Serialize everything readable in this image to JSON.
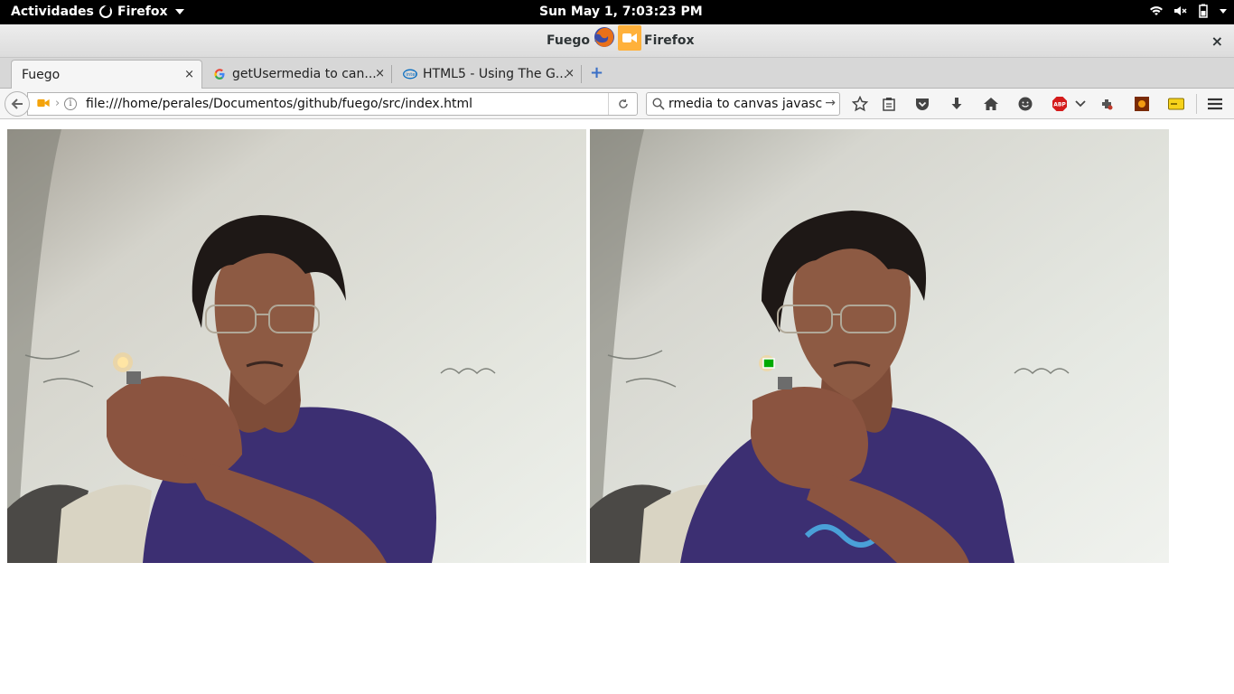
{
  "topbar": {
    "activities": "Actividades",
    "app_name": "Firefox",
    "clock": "Sun May  1,  7:03:23 PM"
  },
  "window": {
    "title_left": "Fuego –",
    "title_right": "Firefox",
    "close": "×"
  },
  "tabs": [
    {
      "label": "Fuego",
      "close": "×"
    },
    {
      "label": "getUsermedia to can...",
      "close": "×"
    },
    {
      "label": "HTML5 - Using The G...",
      "close": "×"
    }
  ],
  "newtab": "+",
  "navbar": {
    "url": "file:///home/perales/Documentos/github/fuego/src/index.html",
    "search_value": "rmedia to canvas javascript",
    "info_glyph": "i"
  },
  "colors": {
    "accent_blue": "#3a6fc6",
    "camera_orange": "#ffb13b",
    "wall": "#dcdcd2",
    "shirt": "#3c2f72",
    "skin": "#8d5a43",
    "hair": "#1e1816"
  },
  "content": {
    "left_video": "webcam-frame-original",
    "right_video": "webcam-frame-processed",
    "marker_color": "#00aa00"
  }
}
